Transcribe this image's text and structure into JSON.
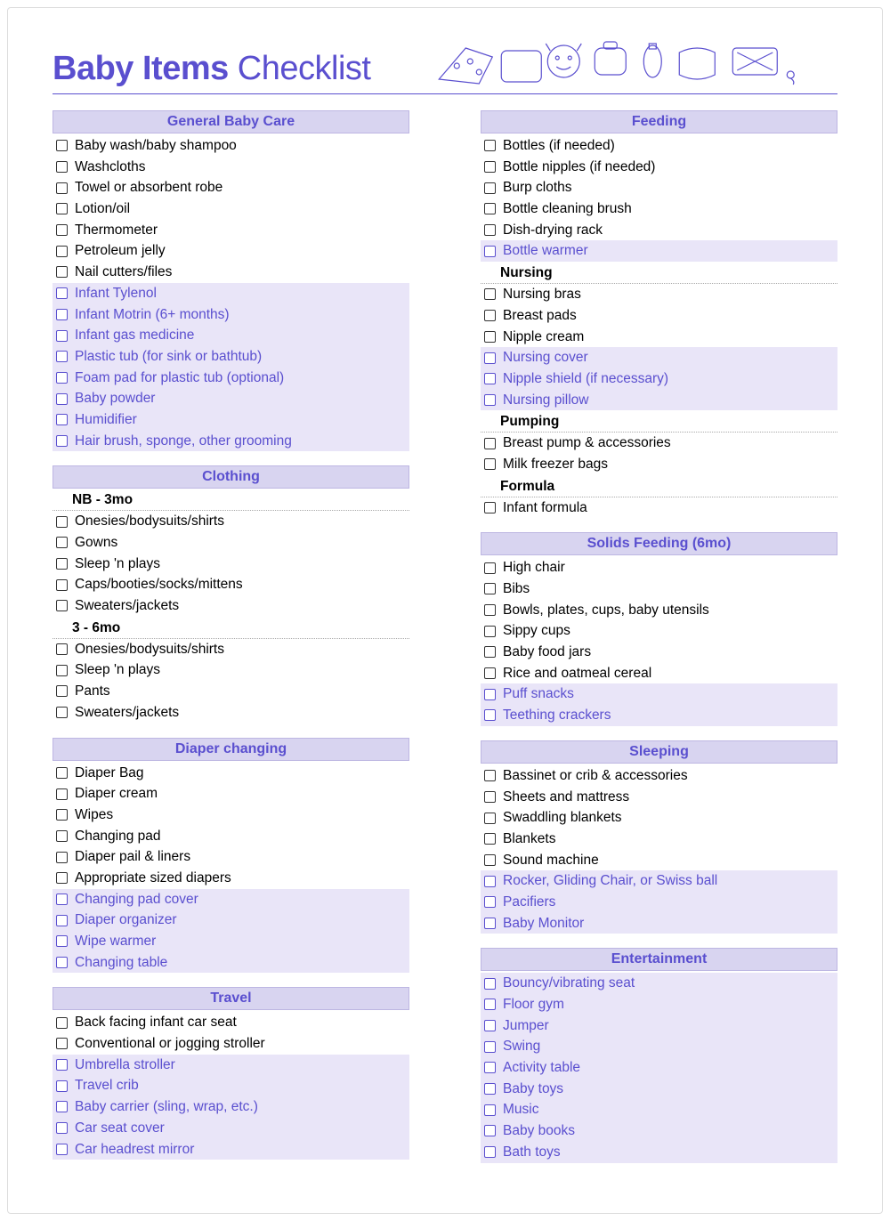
{
  "title_bold": "Baby Items",
  "title_rest": " Checklist",
  "left": [
    {
      "header": "General Baby Care",
      "groups": [
        {
          "items": [
            {
              "t": "Baby wash/baby shampoo",
              "hl": false
            },
            {
              "t": "Washcloths",
              "hl": false
            },
            {
              "t": "Towel or absorbent robe",
              "hl": false
            },
            {
              "t": "Lotion/oil",
              "hl": false
            },
            {
              "t": "Thermometer",
              "hl": false
            },
            {
              "t": "Petroleum jelly",
              "hl": false
            },
            {
              "t": "Nail cutters/files",
              "hl": false
            },
            {
              "t": "Infant Tylenol",
              "hl": true
            },
            {
              "t": "Infant Motrin (6+ months)",
              "hl": true
            },
            {
              "t": "Infant gas medicine",
              "hl": true
            },
            {
              "t": "Plastic tub (for sink or bathtub)",
              "hl": true
            },
            {
              "t": "Foam pad for plastic tub (optional)",
              "hl": true
            },
            {
              "t": "Baby powder",
              "hl": true
            },
            {
              "t": "Humidifier",
              "hl": true
            },
            {
              "t": "Hair brush, sponge, other grooming",
              "hl": true
            }
          ]
        }
      ]
    },
    {
      "header": "Clothing",
      "groups": [
        {
          "sub": "NB - 3mo",
          "items": [
            {
              "t": "Onesies/bodysuits/shirts",
              "hl": false
            },
            {
              "t": "Gowns",
              "hl": false
            },
            {
              "t": "Sleep 'n plays",
              "hl": false
            },
            {
              "t": "Caps/booties/socks/mittens",
              "hl": false
            },
            {
              "t": "Sweaters/jackets",
              "hl": false
            }
          ]
        },
        {
          "sub": "3 - 6mo",
          "items": [
            {
              "t": "Onesies/bodysuits/shirts",
              "hl": false
            },
            {
              "t": "Sleep 'n plays",
              "hl": false
            },
            {
              "t": "Pants",
              "hl": false
            },
            {
              "t": "Sweaters/jackets",
              "hl": false
            }
          ]
        }
      ]
    },
    {
      "header": "Diaper changing",
      "groups": [
        {
          "items": [
            {
              "t": "Diaper Bag",
              "hl": false
            },
            {
              "t": "Diaper cream",
              "hl": false
            },
            {
              "t": "Wipes",
              "hl": false
            },
            {
              "t": "Changing pad",
              "hl": false
            },
            {
              "t": "Diaper pail & liners",
              "hl": false
            },
            {
              "t": "Appropriate sized diapers",
              "hl": false
            },
            {
              "t": "Changing pad cover",
              "hl": true
            },
            {
              "t": "Diaper organizer",
              "hl": true
            },
            {
              "t": "Wipe warmer",
              "hl": true
            },
            {
              "t": "Changing table",
              "hl": true
            }
          ]
        }
      ]
    },
    {
      "header": "Travel",
      "groups": [
        {
          "items": [
            {
              "t": "Back facing infant car seat",
              "hl": false
            },
            {
              "t": "Conventional or jogging stroller",
              "hl": false
            },
            {
              "t": "Umbrella stroller",
              "hl": true
            },
            {
              "t": "Travel crib",
              "hl": true
            },
            {
              "t": "Baby carrier (sling, wrap, etc.)",
              "hl": true
            },
            {
              "t": "Car seat cover",
              "hl": true
            },
            {
              "t": "Car headrest mirror",
              "hl": true
            }
          ]
        }
      ]
    }
  ],
  "right": [
    {
      "header": "Feeding",
      "groups": [
        {
          "items": [
            {
              "t": "Bottles (if needed)",
              "hl": false
            },
            {
              "t": "Bottle nipples (if needed)",
              "hl": false
            },
            {
              "t": "Burp cloths",
              "hl": false
            },
            {
              "t": "Bottle cleaning brush",
              "hl": false
            },
            {
              "t": "Dish-drying rack",
              "hl": false
            },
            {
              "t": "Bottle warmer",
              "hl": true
            }
          ]
        },
        {
          "sub": "Nursing",
          "items": [
            {
              "t": "Nursing bras",
              "hl": false
            },
            {
              "t": "Breast pads",
              "hl": false
            },
            {
              "t": "Nipple cream",
              "hl": false
            },
            {
              "t": "Nursing cover",
              "hl": true
            },
            {
              "t": "Nipple shield (if necessary)",
              "hl": true
            },
            {
              "t": "Nursing pillow",
              "hl": true
            }
          ]
        },
        {
          "sub": "Pumping",
          "items": [
            {
              "t": "Breast pump & accessories",
              "hl": false
            },
            {
              "t": "Milk freezer bags",
              "hl": false
            }
          ]
        },
        {
          "sub": "Formula",
          "items": [
            {
              "t": "Infant formula",
              "hl": false
            }
          ]
        }
      ]
    },
    {
      "header": "Solids Feeding (6mo)",
      "groups": [
        {
          "items": [
            {
              "t": "High chair",
              "hl": false
            },
            {
              "t": "Bibs",
              "hl": false
            },
            {
              "t": "Bowls, plates, cups, baby utensils",
              "hl": false
            },
            {
              "t": "Sippy cups",
              "hl": false
            },
            {
              "t": "Baby food jars",
              "hl": false
            },
            {
              "t": "Rice and oatmeal cereal",
              "hl": false
            },
            {
              "t": "Puff snacks",
              "hl": true
            },
            {
              "t": "Teething crackers",
              "hl": true
            }
          ]
        }
      ]
    },
    {
      "header": "Sleeping",
      "groups": [
        {
          "items": [
            {
              "t": "Bassinet or crib & accessories",
              "hl": false
            },
            {
              "t": "Sheets and mattress",
              "hl": false
            },
            {
              "t": "Swaddling blankets",
              "hl": false
            },
            {
              "t": "Blankets",
              "hl": false
            },
            {
              "t": "Sound machine",
              "hl": false
            },
            {
              "t": "Rocker, Gliding Chair, or Swiss ball",
              "hl": true
            },
            {
              "t": "Pacifiers",
              "hl": true
            },
            {
              "t": "Baby Monitor",
              "hl": true
            }
          ]
        }
      ]
    },
    {
      "header": "Entertainment",
      "groups": [
        {
          "items": [
            {
              "t": "Bouncy/vibrating seat",
              "hl": true
            },
            {
              "t": "Floor gym",
              "hl": true
            },
            {
              "t": "Jumper",
              "hl": true
            },
            {
              "t": "Swing",
              "hl": true
            },
            {
              "t": "Activity table",
              "hl": true
            },
            {
              "t": "Baby toys",
              "hl": true
            },
            {
              "t": "Music",
              "hl": true
            },
            {
              "t": "Baby books",
              "hl": true
            },
            {
              "t": "Bath toys",
              "hl": true
            }
          ]
        }
      ]
    }
  ]
}
